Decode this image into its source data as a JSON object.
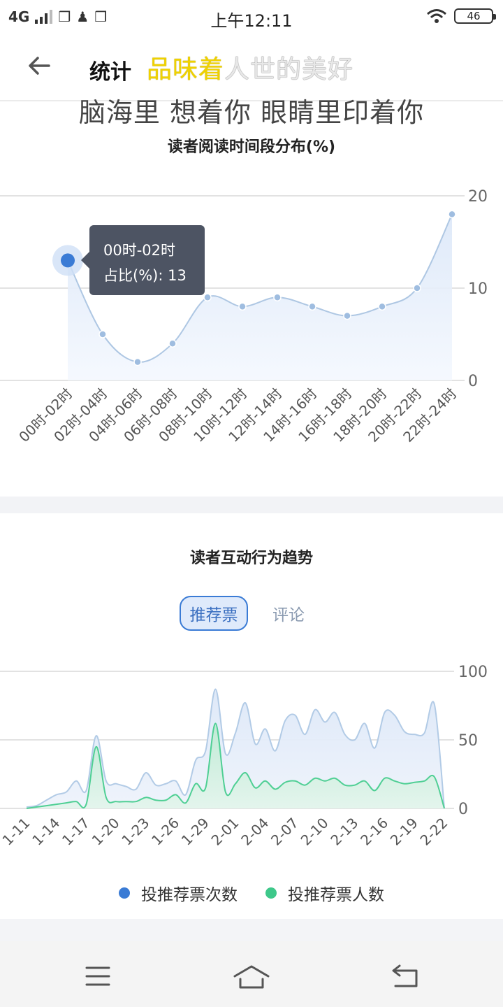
{
  "status_bar": {
    "network": "4G",
    "time": "上午12:11",
    "battery": "46"
  },
  "header": {
    "title": "统计",
    "lyric_line1_highlight": "品味着",
    "lyric_line1_rest": "人世的美好",
    "lyric_line2": "脑海里 想着你 眼睛里印着你"
  },
  "chart1": {
    "title": "读者阅读时间段分布(%)",
    "tooltip": {
      "category": "00时-02时",
      "label": "占比(%): 13"
    }
  },
  "chart2": {
    "title": "读者互动行为趋势"
  },
  "tabs": {
    "active": "推荐票",
    "inactive": "评论"
  },
  "legend": {
    "series1": "投推荐票次数",
    "series2": "投推荐票人数"
  },
  "colors": {
    "line1": "#aec7e3",
    "area1": "#e8f0fb",
    "point_highlight": "#3a7bd5",
    "series1": "#3a7bd5",
    "series2": "#3ec88a",
    "tooltip_bg": "#4d5463"
  },
  "chart_data": [
    {
      "type": "area",
      "title": "读者阅读时间段分布(%)",
      "categories": [
        "00时-02时",
        "02时-04时",
        "04时-06时",
        "06时-08时",
        "08时-10时",
        "10时-12时",
        "12时-14时",
        "14时-16时",
        "16时-18时",
        "18时-20时",
        "20时-22时",
        "22时-24时"
      ],
      "values": [
        13,
        5,
        2,
        4,
        9,
        8,
        9,
        8,
        7,
        8,
        10,
        18
      ],
      "ylim": [
        0,
        20
      ],
      "yticks": [
        0,
        10,
        20
      ],
      "grid": true
    },
    {
      "type": "area",
      "title": "读者互动行为趋势",
      "x": [
        "1-11",
        "1-12",
        "1-13",
        "1-14",
        "1-15",
        "1-16",
        "1-17",
        "1-18",
        "1-19",
        "1-20",
        "1-21",
        "1-22",
        "1-23",
        "1-24",
        "1-25",
        "1-26",
        "1-27",
        "1-28",
        "1-29",
        "1-30",
        "1-31",
        "2-01",
        "2-02",
        "2-03",
        "2-04",
        "2-05",
        "2-06",
        "2-07",
        "2-08",
        "2-09",
        "2-10",
        "2-11",
        "2-12",
        "2-13",
        "2-14",
        "2-15",
        "2-16",
        "2-17",
        "2-18",
        "2-19",
        "2-20",
        "2-21",
        "2-22"
      ],
      "xticks": [
        "1-11",
        "1-14",
        "1-17",
        "1-20",
        "1-23",
        "1-26",
        "1-29",
        "2-01",
        "2-04",
        "2-07",
        "2-10",
        "2-13",
        "2-16",
        "2-19",
        "2-22"
      ],
      "ylim": [
        0,
        100
      ],
      "yticks": [
        0,
        50,
        100
      ],
      "grid": true,
      "series": [
        {
          "name": "投推荐票次数",
          "values": [
            1,
            2,
            6,
            10,
            12,
            20,
            13,
            53,
            20,
            18,
            16,
            14,
            26,
            17,
            18,
            20,
            10,
            35,
            42,
            87,
            40,
            55,
            77,
            47,
            58,
            42,
            64,
            68,
            54,
            72,
            63,
            70,
            54,
            50,
            62,
            44,
            70,
            68,
            56,
            54,
            55,
            76,
            0
          ]
        },
        {
          "name": "投推荐票人数",
          "values": [
            0,
            1,
            2,
            3,
            4,
            5,
            3,
            45,
            8,
            5,
            5,
            5,
            8,
            6,
            6,
            10,
            4,
            18,
            15,
            62,
            12,
            18,
            26,
            15,
            20,
            14,
            19,
            20,
            17,
            22,
            20,
            22,
            17,
            17,
            20,
            13,
            22,
            20,
            18,
            19,
            20,
            23,
            0
          ]
        }
      ]
    }
  ]
}
